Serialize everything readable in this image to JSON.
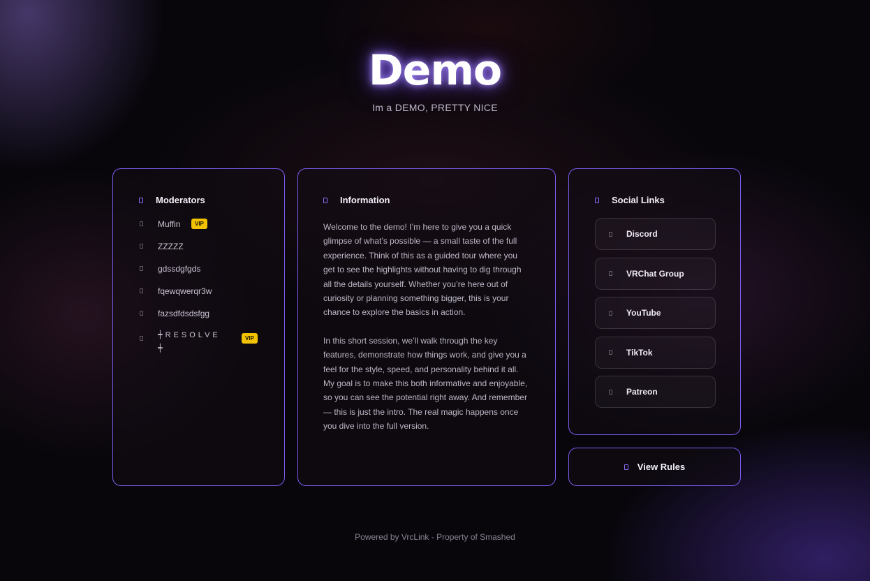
{
  "hero": {
    "title": "Demo",
    "subtitle": "Im a DEMO, PRETTY NICE"
  },
  "moderators": {
    "heading": "Moderators",
    "items": [
      {
        "name": "Muffin",
        "badge": "VIP"
      },
      {
        "name": "ZZZZZ",
        "badge": ""
      },
      {
        "name": "gdssdgfgds",
        "badge": ""
      },
      {
        "name": "fqewqwerqr3w",
        "badge": ""
      },
      {
        "name": "fazsdfdsdsfgg",
        "badge": ""
      },
      {
        "name": "┿RESOLVE┿",
        "badge": "VIP"
      }
    ]
  },
  "information": {
    "heading": "Information",
    "paragraphs": [
      "Welcome to the demo! I’m here to give you a quick glimpse of what’s possible — a small taste of the full experience. Think of this as a guided tour where you get to see the highlights without having to dig through all the details yourself. Whether you’re here out of curiosity or planning something bigger, this is your chance to explore the basics in action.",
      "In this short session, we’ll walk through the key features, demonstrate how things work, and give you a feel for the style, speed, and personality behind it all. My goal is to make this both informative and enjoyable, so you can see the potential right away. And remember — this is just the intro. The real magic happens once you dive into the full version."
    ]
  },
  "social": {
    "heading": "Social Links",
    "links": [
      {
        "label": "Discord",
        "icon": "discord-icon"
      },
      {
        "label": "VRChat Group",
        "icon": "vrchat-icon"
      },
      {
        "label": "YouTube",
        "icon": "youtube-icon"
      },
      {
        "label": "TikTok",
        "icon": "tiktok-icon"
      },
      {
        "label": "Patreon",
        "icon": "patreon-icon"
      }
    ]
  },
  "rules": {
    "label": "View Rules",
    "icon": "book-icon"
  },
  "footer": {
    "text": "Powered by VrcLink - Property of Smashed"
  },
  "colors": {
    "accent": "#7b5df0",
    "vip": "#f2c200",
    "background": "#08060b"
  }
}
